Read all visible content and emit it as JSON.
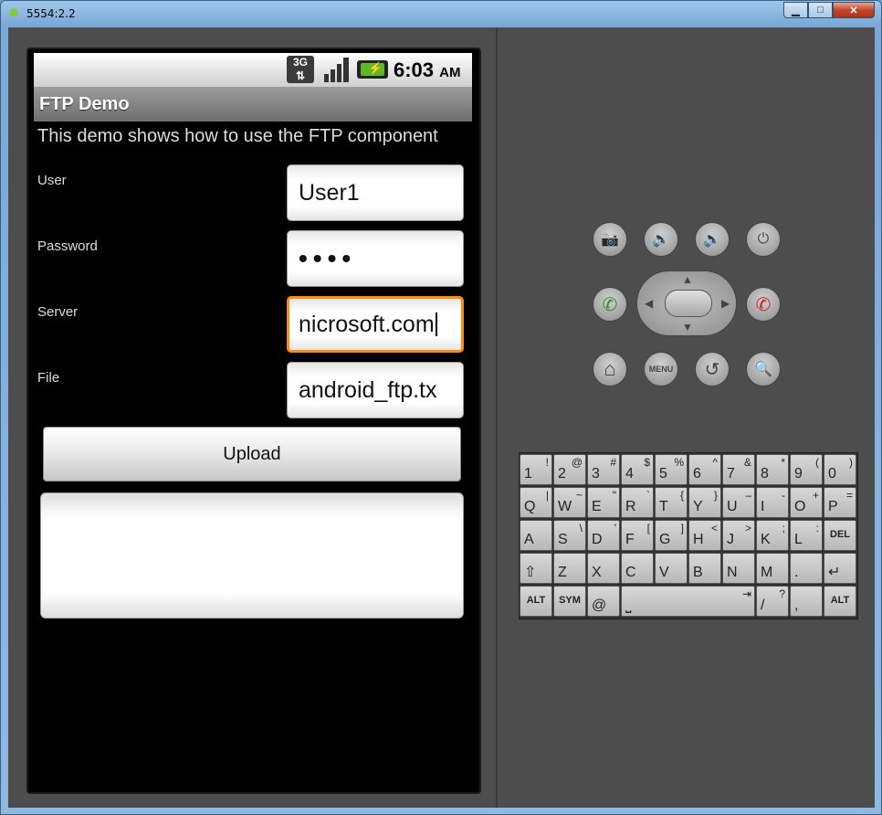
{
  "window": {
    "title": "5554:2.2",
    "min": "▁",
    "max": "□",
    "close": "✕"
  },
  "statusbar": {
    "network": "3G",
    "network_sub": "⇅",
    "time": "6:03",
    "ampm": "AM",
    "battery_glyph": "⚡"
  },
  "app": {
    "title": "FTP Demo",
    "intro": "This demo shows how to use the FTP component",
    "fields": [
      {
        "label": "User",
        "value": "User1"
      },
      {
        "label": "Password",
        "value": "••••"
      },
      {
        "label": "Server",
        "value": "nicrosoft.com"
      },
      {
        "label": "File",
        "value": "android_ftp.tx"
      }
    ],
    "upload_label": "Upload",
    "log_text": ""
  },
  "controls": {
    "camera_glyph": "📷",
    "vol_down_glyph": "🔉",
    "vol_up_glyph": "🔊",
    "power_glyph": "⏻",
    "call_glyph": "✆",
    "end_glyph": "✆",
    "home_glyph": "⌂",
    "menu_label": "MENU",
    "back_glyph": "↺",
    "search_glyph": "🔍"
  },
  "keyboard": {
    "rows": [
      [
        [
          "1",
          "!"
        ],
        [
          "2",
          "@"
        ],
        [
          "3",
          "#"
        ],
        [
          "4",
          "$"
        ],
        [
          "5",
          "%"
        ],
        [
          "6",
          "^"
        ],
        [
          "7",
          "&"
        ],
        [
          "8",
          "*"
        ],
        [
          "9",
          "("
        ],
        [
          "0",
          ")"
        ]
      ],
      [
        [
          "Q",
          "|"
        ],
        [
          "W",
          "~"
        ],
        [
          "E",
          "\""
        ],
        [
          "R",
          "`"
        ],
        [
          "T",
          "{"
        ],
        [
          "Y",
          "}"
        ],
        [
          "U",
          "–"
        ],
        [
          "I",
          "-"
        ],
        [
          "O",
          "+"
        ],
        [
          "P",
          "="
        ]
      ],
      [
        [
          "A",
          ""
        ],
        [
          "S",
          "\\"
        ],
        [
          "D",
          "'"
        ],
        [
          "F",
          "["
        ],
        [
          "G",
          "]"
        ],
        [
          "H",
          "<"
        ],
        [
          "J",
          ">"
        ],
        [
          "K",
          ";"
        ],
        [
          "L",
          ":"
        ],
        [
          "DEL",
          ""
        ]
      ],
      [
        [
          "⇧",
          ""
        ],
        [
          "Z",
          ""
        ],
        [
          "X",
          ""
        ],
        [
          "C",
          ""
        ],
        [
          "V",
          ""
        ],
        [
          "B",
          ""
        ],
        [
          "N",
          ""
        ],
        [
          "M",
          ""
        ],
        [
          ".",
          ""
        ],
        [
          "↵",
          ""
        ]
      ],
      [
        [
          "ALT",
          ""
        ],
        [
          "SYM",
          ""
        ],
        [
          "@",
          ""
        ],
        [
          "⎵",
          "⇥"
        ],
        [
          "/",
          "?"
        ],
        [
          ",",
          ""
        ],
        [
          "ALT",
          ""
        ]
      ]
    ]
  }
}
